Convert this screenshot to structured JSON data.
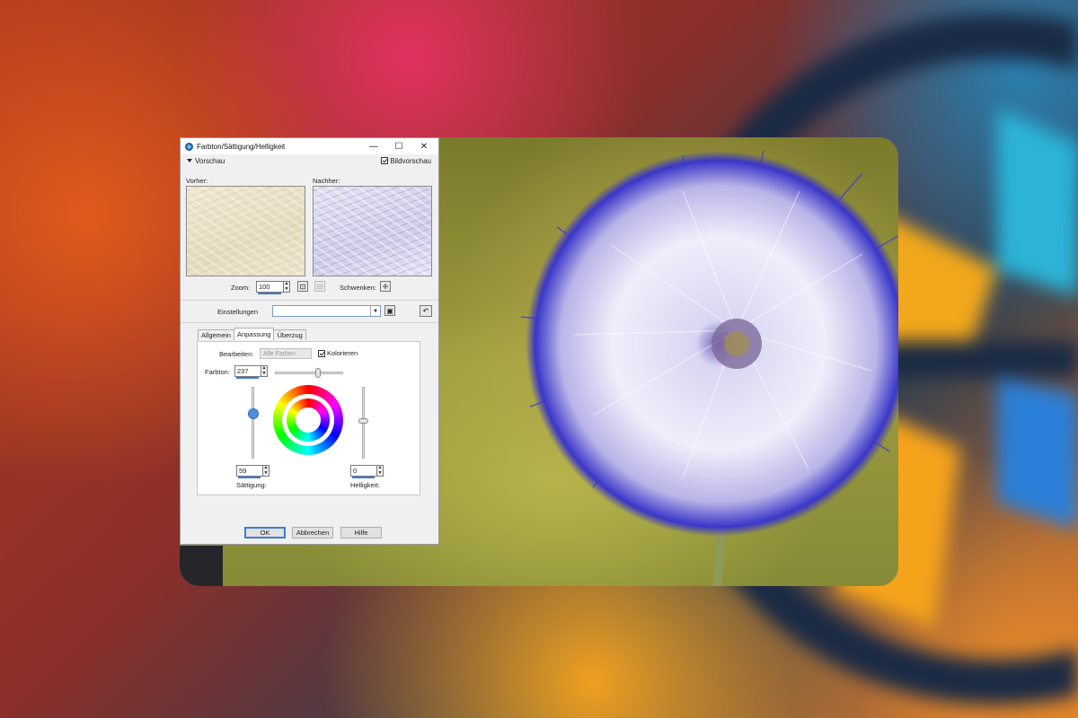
{
  "dialog": {
    "title": "Farbton/Sättigung/Helligkeit",
    "minimize": "—",
    "maximize": "☐",
    "close": "✕",
    "preview_toggle": "Vorschau",
    "image_preview_label": "Bildvorschau",
    "image_preview_checked": true,
    "before_label": "Vorher:",
    "after_label": "Nachher:",
    "zoom_label": "Zoom:",
    "zoom_value": "100",
    "pan_label": "Schwenken:",
    "settings_label": "Einstellungen",
    "settings_value": "",
    "tabs": [
      {
        "label": "Allgemein",
        "active": false
      },
      {
        "label": "Anpassung",
        "active": true
      },
      {
        "label": "Überzug",
        "active": false
      }
    ],
    "edit_label": "Bearbeiten:",
    "edit_value": "Alle Farben",
    "colorize_label": "Kolorieren",
    "colorize_checked": true,
    "hue_label": "Farbton:",
    "hue_value": "237",
    "saturation_label": "Sättigung:",
    "saturation_value": "59",
    "lightness_label": "Helligkeit:",
    "lightness_value": "0",
    "ok_label": "OK",
    "cancel_label": "Abbrechen",
    "help_label": "Hilfe"
  },
  "icons": {
    "app": "paint-shop-icon",
    "collapse": "triangle-down-icon",
    "zoom_fit": "zoom-fit-icon",
    "zoom_actual": "zoom-actual-icon",
    "pan": "crosshair-icon",
    "save_preset": "save-icon",
    "reset_preset": "reset-icon",
    "dropdown": "chevron-down-icon"
  },
  "colors": {
    "accent": "#3b7cd6",
    "dialog_bg": "#f0f0f0",
    "colorize_tint": "#5a50c8"
  }
}
